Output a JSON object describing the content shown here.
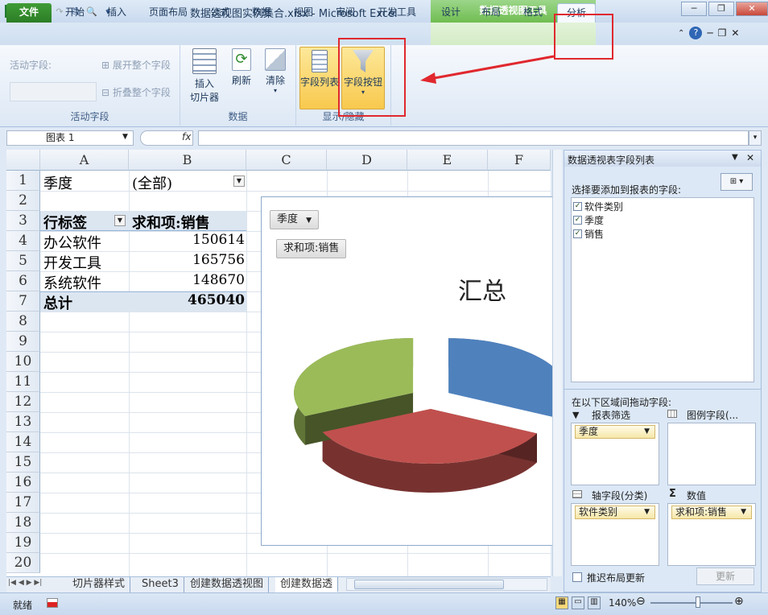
{
  "title_bar": {
    "window_title": "数据透视图实例集合.xlsx - Microsoft Excel",
    "context_title": "数据透视图工具"
  },
  "tabs": [
    {
      "label": "文件"
    },
    {
      "label": "开始"
    },
    {
      "label": "插入"
    },
    {
      "label": "页面布局"
    },
    {
      "label": "公式"
    },
    {
      "label": "数据"
    },
    {
      "label": "视图"
    },
    {
      "label": "审阅"
    },
    {
      "label": "开发工具"
    },
    {
      "label": "设计"
    },
    {
      "label": "布局"
    },
    {
      "label": "格式"
    },
    {
      "label": "分析"
    }
  ],
  "ribbon": {
    "active_field": {
      "label": "活动字段:",
      "expand": "展开整个字段",
      "collapse": "折叠整个字段",
      "group": "活动字段"
    },
    "data": {
      "insert_slicer": "插入",
      "insert_slicer2": "切片器",
      "refresh": "刷新",
      "clear": "清除",
      "group": "数据"
    },
    "show_hide": {
      "field_list": "字段列表",
      "field_buttons": "字段按钮",
      "group": "显示/隐藏"
    }
  },
  "formula_bar": {
    "name_box": "图表 1",
    "fx": "fx",
    "value": ""
  },
  "sheet": {
    "columns": [
      "A",
      "B",
      "C",
      "D",
      "E",
      "F"
    ],
    "rows": [
      "1",
      "2",
      "3",
      "4",
      "5",
      "6",
      "7",
      "8",
      "9",
      "10",
      "11",
      "12",
      "13",
      "14",
      "15",
      "16",
      "17",
      "18",
      "19",
      "20"
    ],
    "filter_label": "季度",
    "filter_value": "(全部)",
    "pivot_header_row": "行标签",
    "pivot_header_sum": "求和项:销售",
    "pivot_rows": [
      {
        "label": "办公软件",
        "value": "150614"
      },
      {
        "label": "开发工具",
        "value": "165756"
      },
      {
        "label": "系统软件",
        "value": "148670"
      }
    ],
    "total_label": "总计",
    "total_value": "465040"
  },
  "chart_data": {
    "type": "pie",
    "title": "汇总",
    "categories": [
      "办公软件",
      "开发工具",
      "系统软件"
    ],
    "values": [
      150614,
      165756,
      148670
    ],
    "colors": [
      "#4f81bd",
      "#c0504d",
      "#9bbb59"
    ],
    "filter_button": "季度",
    "value_button": "求和项:销售"
  },
  "sheet_tabs": [
    "切片器样式",
    "Sheet3",
    "创建数据透视图",
    "创建数据透"
  ],
  "field_list": {
    "title": "数据透视表字段列表",
    "choose_label": "选择要添加到报表的字段:",
    "fields": [
      {
        "label": "软件类别",
        "checked": true
      },
      {
        "label": "季度",
        "checked": true
      },
      {
        "label": "销售",
        "checked": true
      }
    ],
    "drag_label": "在以下区域间拖动字段:",
    "report_filter": "报表筛选",
    "legend_fields": "图例字段(...",
    "axis_fields": "轴字段(分类)",
    "values": "数值",
    "filter_item": "季度",
    "axis_item": "软件类别",
    "value_item": "求和项:销售",
    "defer": "推迟布局更新",
    "update": "更新"
  },
  "status": {
    "ready": "就绪",
    "zoom": "140%"
  }
}
